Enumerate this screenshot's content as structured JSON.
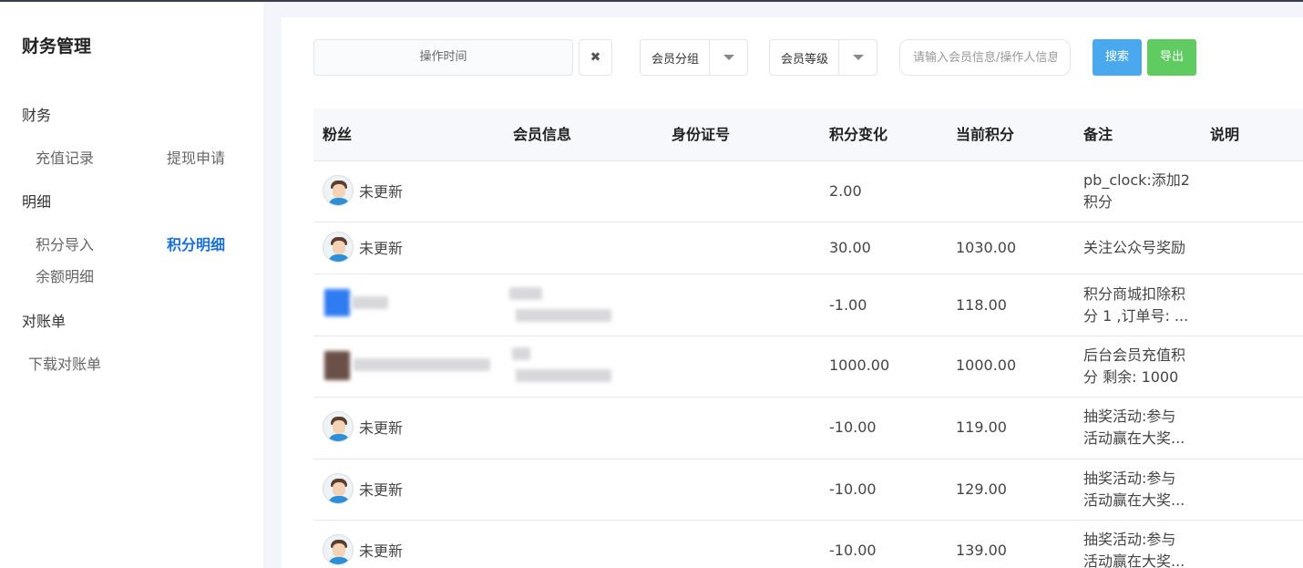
{
  "sidebar": {
    "title": "财务管理",
    "groups": [
      {
        "label": "财务"
      },
      {
        "label": "明细"
      },
      {
        "label": "对账单"
      }
    ],
    "items": {
      "recharge": "充值记录",
      "withdraw": "提现申请",
      "points_import": "积分导入",
      "points_detail": "积分明细",
      "balance_detail": "余额明细",
      "download_statement": "下载对账单"
    }
  },
  "toolbar": {
    "date_placeholder": "操作时间",
    "clear_icon": "✖",
    "member_group": "会员分组",
    "member_level": "会员等级",
    "search_placeholder": "请输入会员信息/操作人信息",
    "search_label": "搜索",
    "export_label": "导出"
  },
  "table": {
    "columns": [
      "粉丝",
      "会员信息",
      "身份证号",
      "积分变化",
      "当前积分",
      "备注",
      "说明"
    ],
    "rows": [
      {
        "fan": "未更新",
        "change": "2.00",
        "current": "",
        "note1": "pb_clock:添加2",
        "note2": "积分"
      },
      {
        "fan": "未更新",
        "change": "30.00",
        "current": "1030.00",
        "note1": "关注公众号奖励",
        "note2": ""
      },
      {
        "fan": "",
        "change": "-1.00",
        "current": "118.00",
        "note1": "积分商城扣除积",
        "note2": "分 1 ,订单号: ..."
      },
      {
        "fan": "",
        "change": "1000.00",
        "current": "1000.00",
        "note1": "后台会员充值积",
        "note2": "分 剩余: 1000"
      },
      {
        "fan": "未更新",
        "change": "-10.00",
        "current": "119.00",
        "note1": "抽奖活动:参与",
        "note2": "活动赢在大奖..."
      },
      {
        "fan": "未更新",
        "change": "-10.00",
        "current": "129.00",
        "note1": "抽奖活动:参与",
        "note2": "活动赢在大奖..."
      },
      {
        "fan": "未更新",
        "change": "-10.00",
        "current": "139.00",
        "note1": "抽奖活动:参与",
        "note2": "活动赢在大奖..."
      }
    ]
  },
  "colors": {
    "accent": "#1a6fd4",
    "search_button": "#4aa9ee",
    "export_button": "#5fcb61"
  }
}
